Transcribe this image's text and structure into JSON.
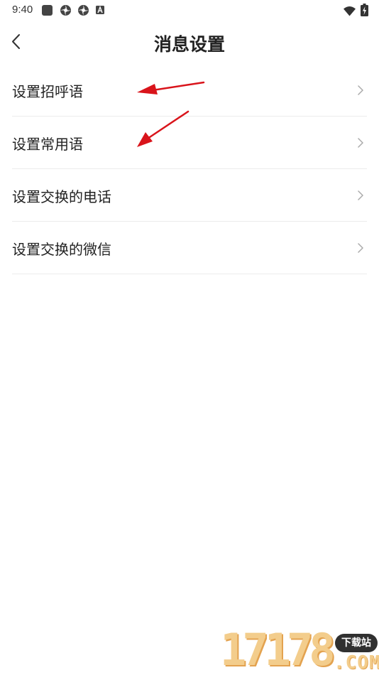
{
  "status_bar": {
    "time": "9:40",
    "icons": [
      "square-icon",
      "gear-icon",
      "gear-icon",
      "a-icon",
      "wifi-icon",
      "battery-icon"
    ]
  },
  "header": {
    "title": "消息设置",
    "back_icon": "chevron-left-icon"
  },
  "menu": {
    "items": [
      {
        "label": "设置招呼语"
      },
      {
        "label": "设置常用语"
      },
      {
        "label": "设置交换的电话"
      },
      {
        "label": "设置交换的微信"
      }
    ],
    "chevron_icon": "chevron-right-icon"
  },
  "annotations": {
    "arrow_color": "#d9141b"
  },
  "watermark": {
    "number": "17178",
    "badge": "下载站",
    "suffix": ".COM"
  }
}
